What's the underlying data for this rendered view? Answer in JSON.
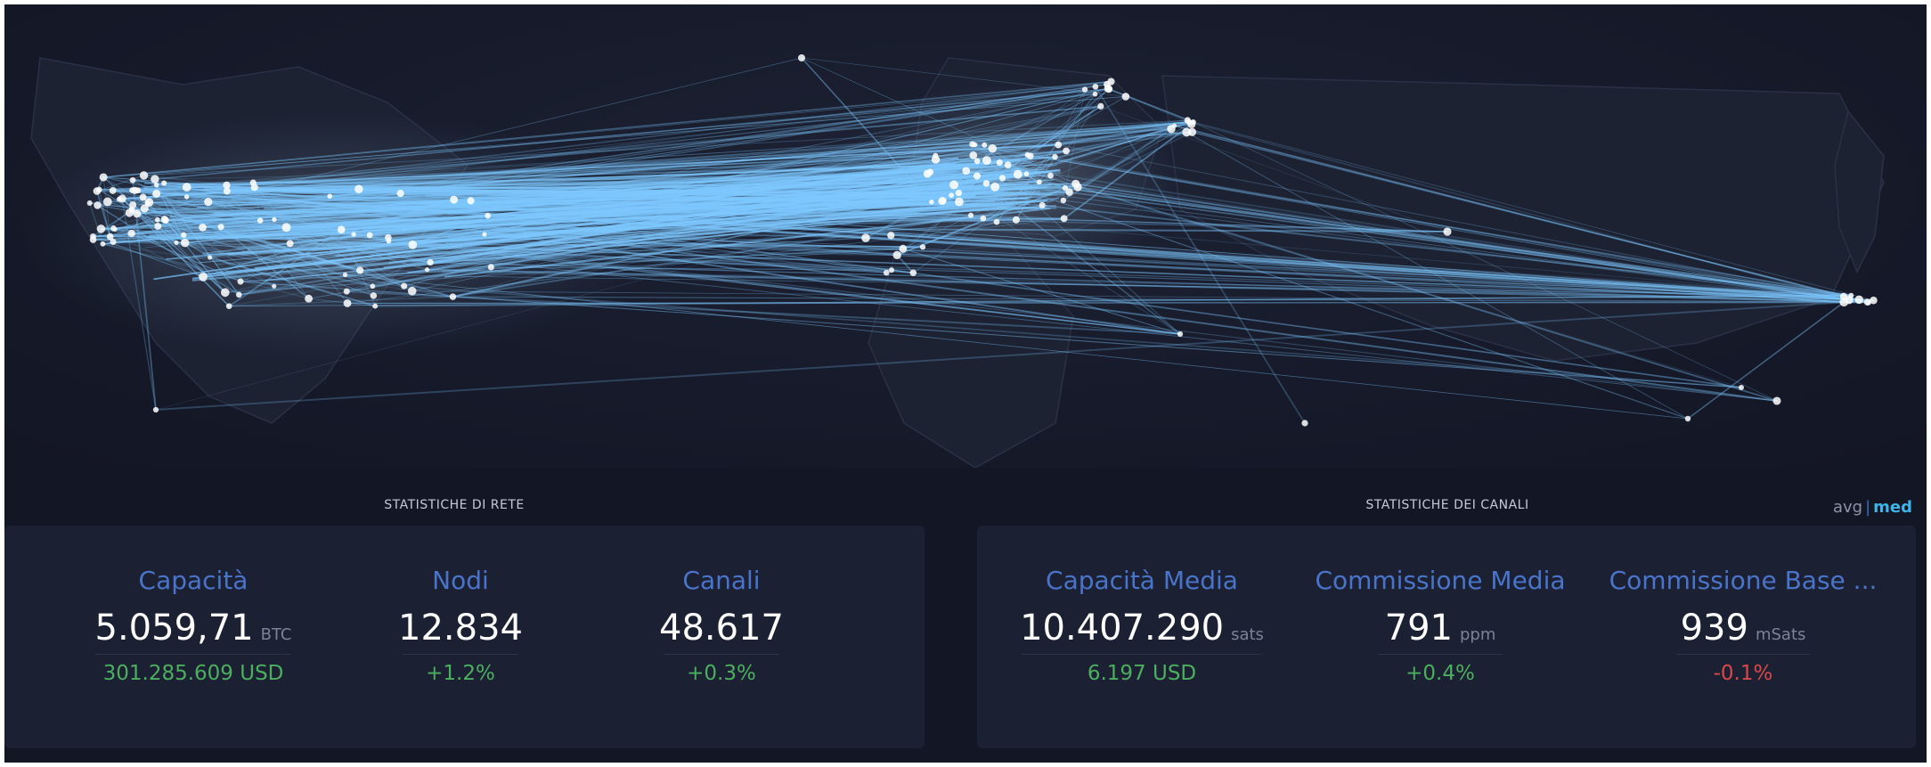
{
  "colors": {
    "background": "#131624",
    "card": "#1c2033",
    "label": "#4a74c9",
    "positive": "#4cae5f",
    "negative": "#d94848",
    "link": "#7ec8ff",
    "toggle_active": "#3fb4e8"
  },
  "network_stats": {
    "title": "STATISTICHE DI RETE",
    "capacity": {
      "label": "Capacità",
      "value": "5.059,71",
      "unit": "BTC",
      "sub": "301.285.609 USD"
    },
    "nodes": {
      "label": "Nodi",
      "value": "12.834",
      "sub": "+1.2%"
    },
    "channels": {
      "label": "Canali",
      "value": "48.617",
      "sub": "+0.3%"
    }
  },
  "channel_stats": {
    "title": "STATISTICHE DEI CANALI",
    "toggle": {
      "avg": "avg",
      "sep": "|",
      "med": "med"
    },
    "avg_capacity": {
      "label": "Capacità Media",
      "value": "10.407.290",
      "unit": "sats",
      "sub": "6.197 USD"
    },
    "avg_fee": {
      "label": "Commissione Media",
      "value": "791",
      "unit": "ppm",
      "sub": "+0.4%"
    },
    "base_fee": {
      "label": "Commissione Base ...",
      "value": "939",
      "unit": "mSats",
      "sub": "-0.1%"
    }
  }
}
